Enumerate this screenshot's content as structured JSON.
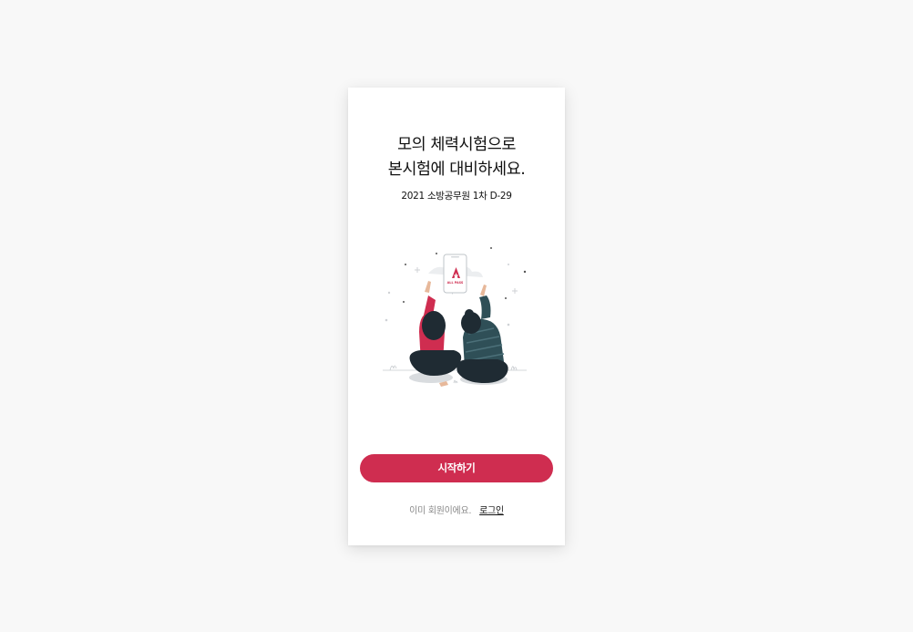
{
  "onboarding": {
    "title_line1": "모의 체력시험으로",
    "title_line2": "본시험에 대비하세요.",
    "subtitle": "2021 소방공무원 1차 D-29",
    "illustration": {
      "icon": "people-pointing-at-phone-illustration",
      "logo_text": "ALL PASS"
    },
    "start_button_label": "시작하기",
    "member_prompt": "이미 회원이에요.",
    "login_link_label": "로그인"
  },
  "colors": {
    "accent": "#cf2d50",
    "background": "#f8f8f8",
    "card": "#ffffff",
    "title_text": "#111111",
    "muted_text": "#8a8a8a"
  }
}
